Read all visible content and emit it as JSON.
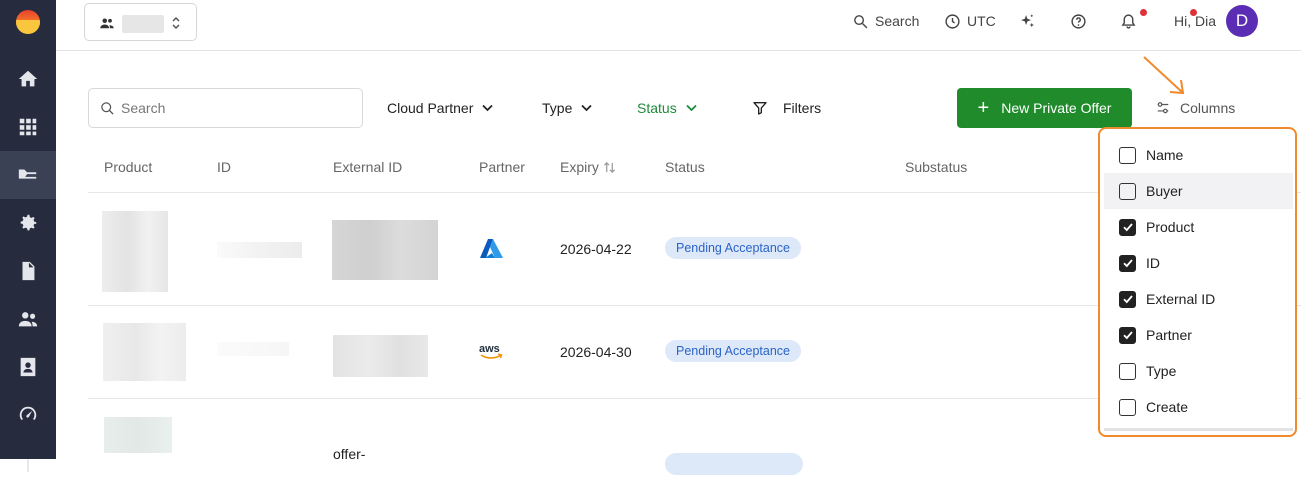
{
  "topbar": {
    "search_label": "Search",
    "timezone_label": "UTC",
    "greeting": "Hi, Dia",
    "avatar_initial": "D"
  },
  "toolbar": {
    "search_placeholder": "Search",
    "cloud_partner_label": "Cloud Partner",
    "type_label": "Type",
    "status_label": "Status",
    "filters_label": "Filters",
    "new_offer_label": "New Private Offer",
    "columns_label": "Columns"
  },
  "table": {
    "headers": [
      "Product",
      "ID",
      "External ID",
      "Partner",
      "Expiry",
      "Status",
      "Substatus"
    ],
    "rows": [
      {
        "partner_icon": "azure-logo",
        "expiry": "2026-04-22",
        "status": "Pending Acceptance"
      },
      {
        "partner_icon": "aws-logo",
        "partner_text": "aws",
        "expiry": "2026-04-30",
        "status": "Pending Acceptance"
      },
      {
        "external_id_partial": "offer-"
      }
    ]
  },
  "columns_menu": {
    "items": [
      {
        "label": "Name",
        "checked": false
      },
      {
        "label": "Buyer",
        "checked": false
      },
      {
        "label": "Product",
        "checked": true
      },
      {
        "label": "ID",
        "checked": true
      },
      {
        "label": "External ID",
        "checked": true
      },
      {
        "label": "Partner",
        "checked": true
      },
      {
        "label": "Type",
        "checked": false
      },
      {
        "label": "Create",
        "checked": false
      }
    ]
  },
  "colors": {
    "sidebar": "#262c3d",
    "primary_green": "#1f8b2b",
    "status_green": "#1e8a3a",
    "badge_bg": "#dde8f9",
    "badge_text": "#2b64c6",
    "highlight_orange": "#f08a2c",
    "avatar": "#5b2db5"
  }
}
